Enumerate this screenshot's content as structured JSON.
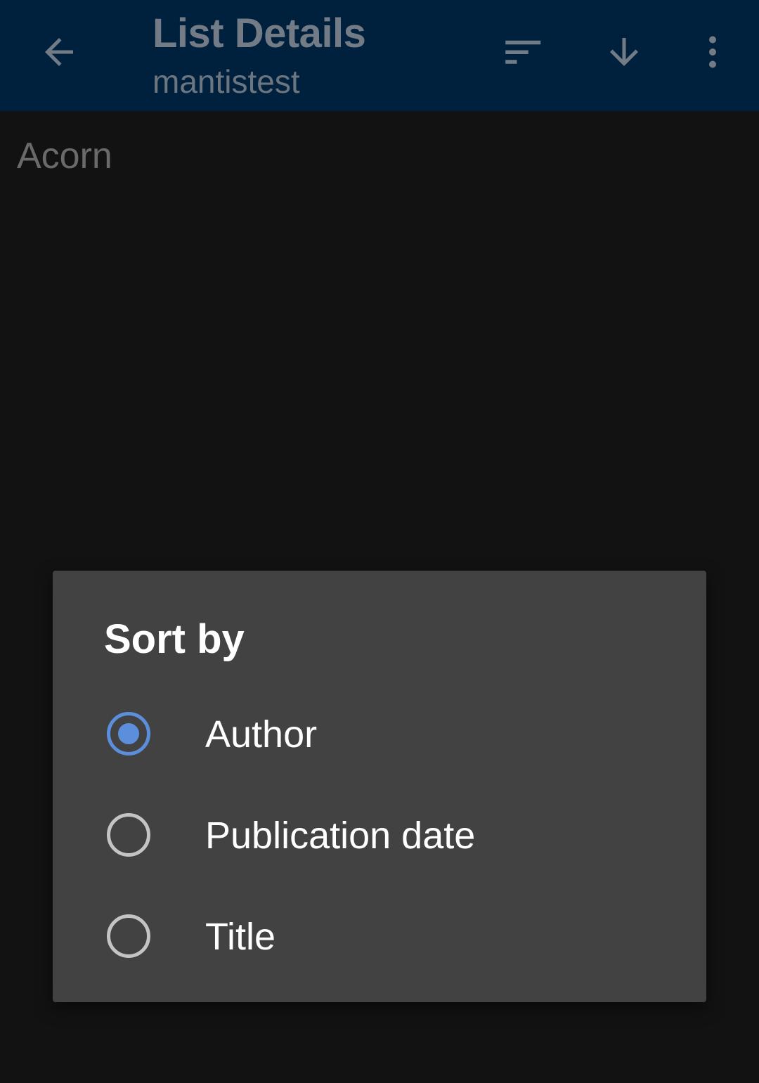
{
  "appbar": {
    "title": "List Details",
    "subtitle": "mantistest",
    "back_icon": "arrow-left-icon",
    "sort_icon": "sort-icon",
    "download_icon": "arrow-down-icon",
    "more_icon": "more-vertical-icon"
  },
  "list": {
    "items": [
      "Acorn"
    ]
  },
  "dialog": {
    "title": "Sort by",
    "options": [
      {
        "label": "Author",
        "selected": true
      },
      {
        "label": "Publication date",
        "selected": false
      },
      {
        "label": "Title",
        "selected": false
      }
    ]
  },
  "colors": {
    "appbar_bg": "#00213e",
    "dialog_bg": "#424242",
    "accent": "#5b8fdc",
    "page_bg": "#121212"
  }
}
